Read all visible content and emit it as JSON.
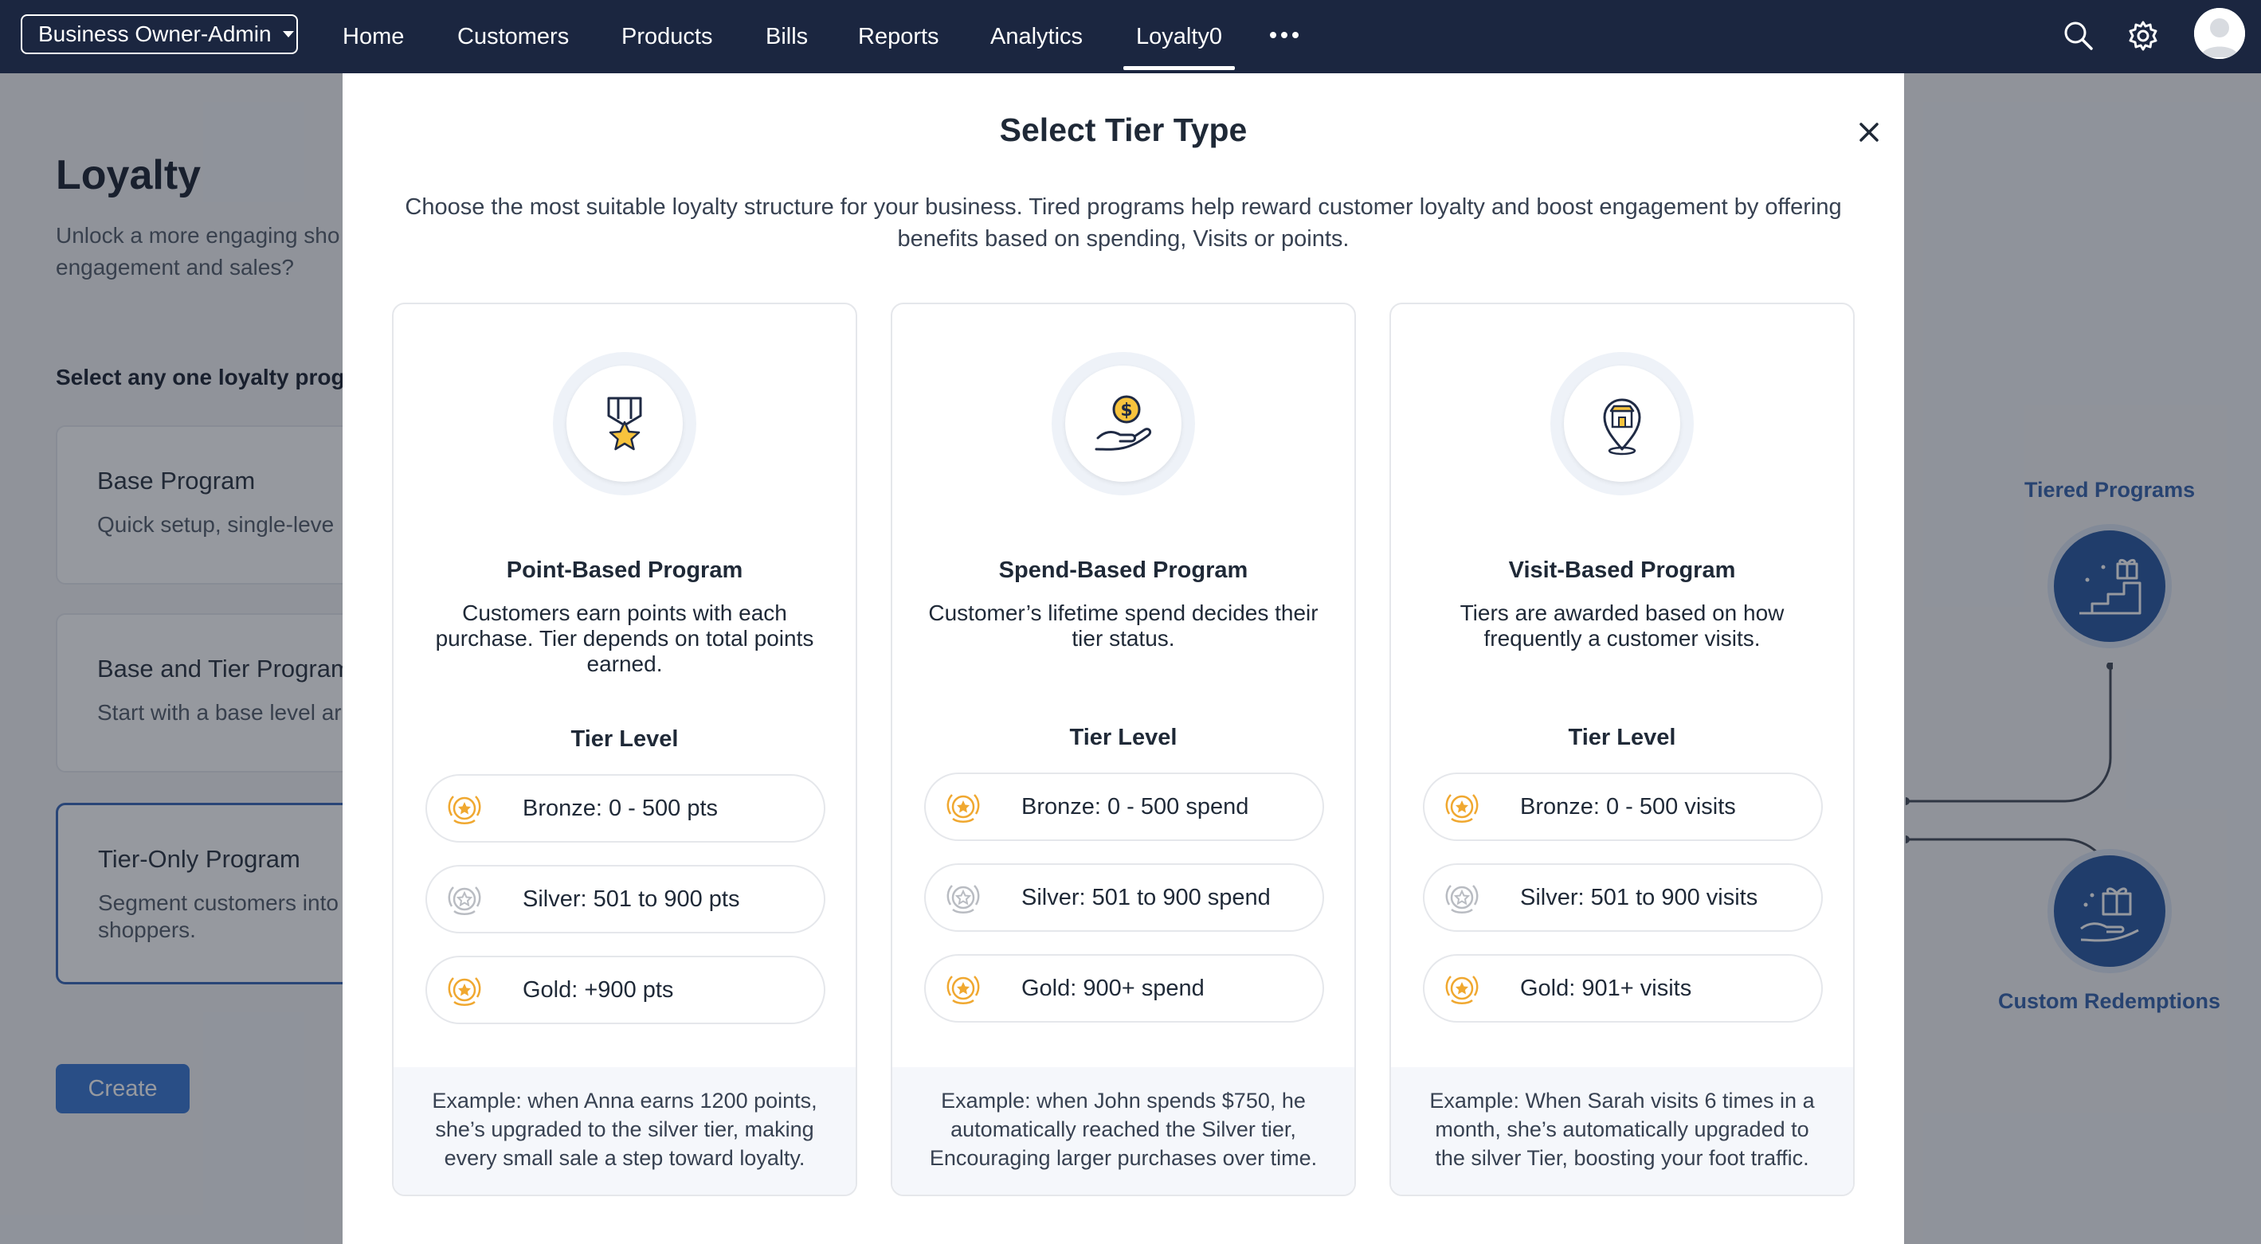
{
  "topnav": {
    "org_select": "Business Owner-Admin",
    "items": [
      "Home",
      "Customers",
      "Products",
      "Bills",
      "Reports",
      "Analytics",
      "Loyalty0"
    ],
    "active_item": "Loyalty0"
  },
  "background": {
    "title": "Loyalty",
    "subtitle_line1": "Unlock a more engaging sho",
    "subtitle_line2": "engagement and sales?",
    "select_label": "Select any one loyalty prog",
    "cards": [
      {
        "title": "Base Program",
        "desc": "Quick setup, single-leve"
      },
      {
        "title": "Base and Tier Program",
        "desc": "Start with a base level ar"
      },
      {
        "title": "Tier-Only Program",
        "desc": "Segment customers into",
        "desc2": "shoppers."
      }
    ],
    "create_button": "Create",
    "tiered_programs_label": "Tiered Programs",
    "custom_redemptions_label": "Custom Redemptions"
  },
  "modal": {
    "title": "Select Tier Type",
    "description": "Choose the most suitable loyalty structure for your business. Tired programs help reward customer loyalty and boost engagement by offering benefits based on spending, Visits or points.",
    "tier_level_heading": "Tier Level",
    "cards": [
      {
        "title": "Point-Based Program",
        "description": "Customers earn points with each purchase. Tier depends on total points earned.",
        "tiers": [
          "Bronze: 0 - 500 pts",
          "Silver: 501 to 900 pts",
          "Gold: +900 pts"
        ],
        "example": "Example: when Anna earns 1200 points, she’s upgraded to the silver tier, making every small sale a step toward loyalty."
      },
      {
        "title": "Spend-Based Program",
        "description": "Customer’s lifetime spend decides their tier status.",
        "tiers": [
          "Bronze: 0 - 500 spend",
          "Silver: 501 to 900 spend",
          "Gold: 900+ spend"
        ],
        "example": "Example: when John spends $750, he automatically reached the Silver tier, Encouraging larger purchases over time."
      },
      {
        "title": "Visit-Based Program",
        "description": "Tiers are awarded based on how frequently a customer visits.",
        "tiers": [
          "Bronze: 0 - 500 visits",
          "Silver: 501 to 900 visits",
          "Gold: 901+ visits"
        ],
        "example": "Example: When Sarah visits 6 times in a month, she’s automatically upgraded to the silver Tier, boosting your foot traffic."
      }
    ]
  },
  "colors": {
    "nav_bg": "#1b2640",
    "accent_blue": "#2f5fb3",
    "bronze": "#f0a830",
    "silver": "#b9bcc2",
    "gold": "#f0a830"
  },
  "icons": [
    "search-icon",
    "gear-icon",
    "avatar",
    "close-icon",
    "medal-star-icon",
    "coin-hand-icon",
    "store-pin-icon",
    "bronze-medal-icon",
    "silver-medal-icon",
    "gold-medal-icon"
  ]
}
